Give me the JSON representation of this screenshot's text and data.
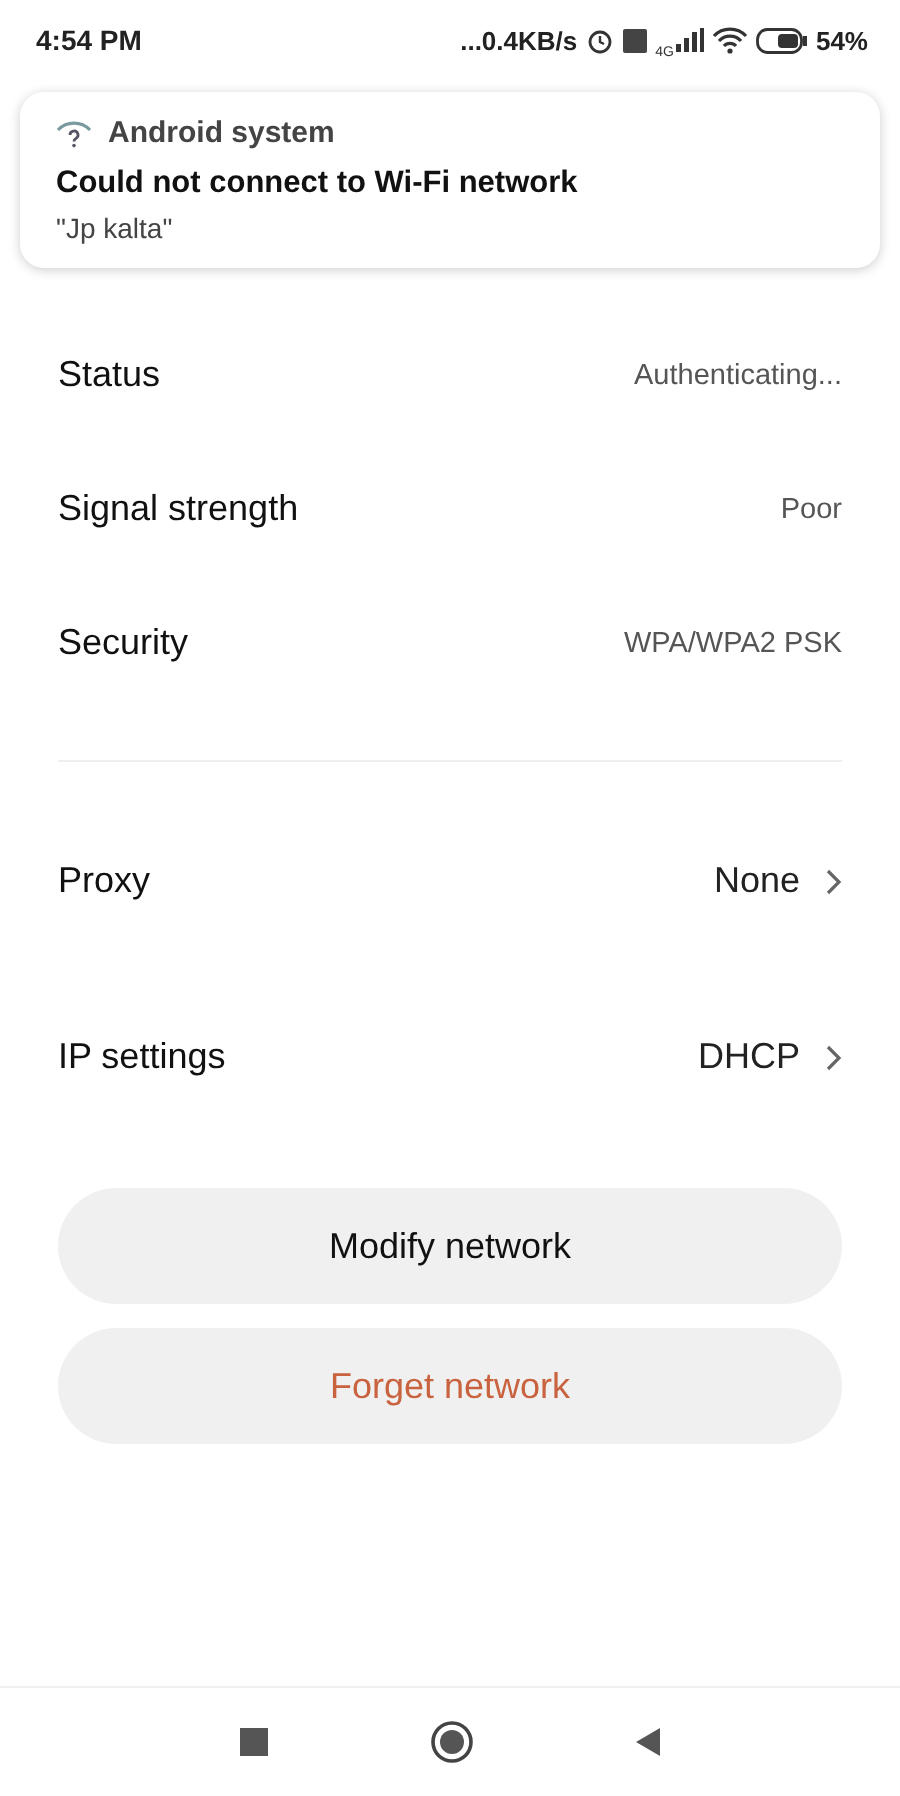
{
  "status_bar": {
    "time": "4:54 PM",
    "speed": "...0.4KB/s",
    "network_type": "4G",
    "battery": "54%"
  },
  "notification": {
    "app": "Android system",
    "title": "Could not connect to Wi-Fi network",
    "text": "\"Jp kalta\""
  },
  "info_rows": [
    {
      "label": "Status",
      "value": "Authenticating..."
    },
    {
      "label": "Signal strength",
      "value": "Poor"
    },
    {
      "label": "Security",
      "value": "WPA/WPA2 PSK"
    }
  ],
  "link_rows": [
    {
      "label": "Proxy",
      "value": "None"
    },
    {
      "label": "IP settings",
      "value": "DHCP"
    }
  ],
  "buttons": [
    {
      "label": "Modify network",
      "kind": "normal"
    },
    {
      "label": "Forget network",
      "kind": "danger"
    }
  ]
}
